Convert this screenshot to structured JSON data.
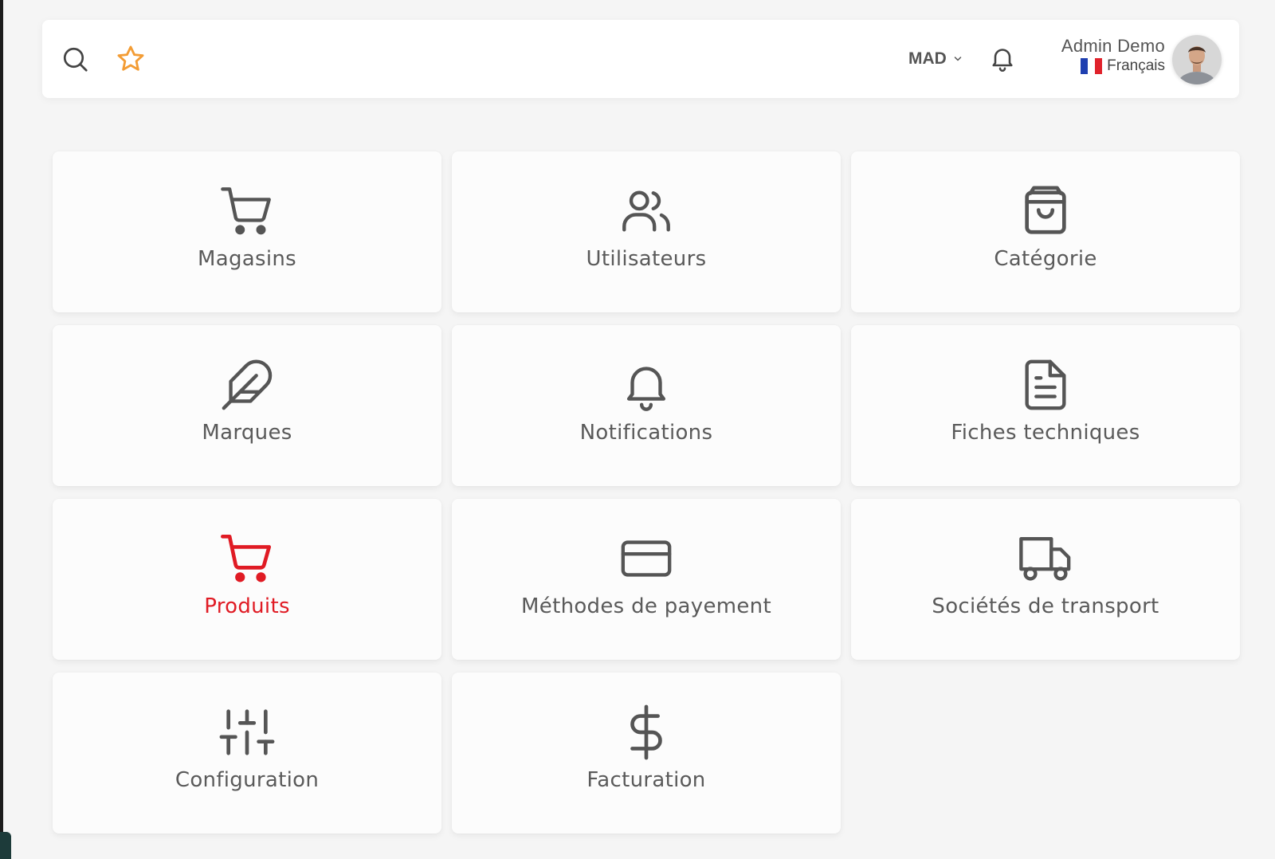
{
  "header": {
    "currency": "MAD",
    "user_name": "Admin Demo",
    "language": "Français",
    "icons": [
      "search-icon",
      "star-icon",
      "chevron-down-icon",
      "bell-icon",
      "avatar"
    ],
    "favorite_color": "#f39c34"
  },
  "tiles": [
    {
      "label": "Magasins",
      "icon": "cart-icon"
    },
    {
      "label": "Utilisateurs",
      "icon": "users-icon"
    },
    {
      "label": "Catégorie",
      "icon": "shopping-bag-icon"
    },
    {
      "label": "Marques",
      "icon": "feather-icon"
    },
    {
      "label": "Notifications",
      "icon": "bell-icon"
    },
    {
      "label": "Fiches techniques",
      "icon": "document-icon"
    },
    {
      "label": "Produits",
      "icon": "cart-icon",
      "active": true
    },
    {
      "label": "Méthodes de payement",
      "icon": "credit-card-icon"
    },
    {
      "label": "Sociétés de transport",
      "icon": "truck-icon"
    },
    {
      "label": "Configuration",
      "icon": "sliders-icon"
    },
    {
      "label": "Facturation",
      "icon": "dollar-icon"
    }
  ],
  "colors": {
    "icon_gray": "#555555",
    "active_red": "#e01b24",
    "background": "#f5f5f5",
    "card": "#fcfcfc"
  }
}
